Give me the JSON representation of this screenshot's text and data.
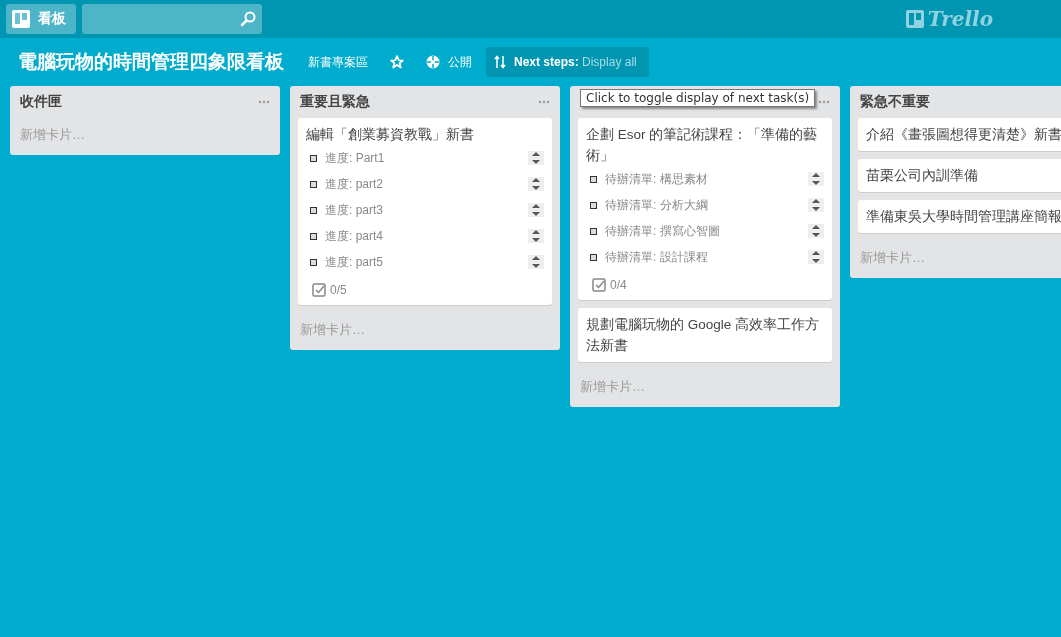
{
  "header": {
    "boards_button": "看板",
    "logo_text": "Trello"
  },
  "board": {
    "title": "電腦玩物的時間管理四象限看板",
    "team": "新書專案區",
    "starred": false,
    "visibility": "公開",
    "next_steps": {
      "label": "Next steps:",
      "value": "Display all"
    }
  },
  "tooltip": "Click to toggle display of next task(s)",
  "lists": [
    {
      "title": "收件匣",
      "add_card": "新增卡片…"
    },
    {
      "title": "重要且緊急",
      "cards": [
        {
          "title": "編輯「創業募資教戰」新書",
          "tasks": [
            "進度: Part1",
            "進度: part2",
            "進度: part3",
            "進度: part4",
            "進度: part5"
          ],
          "checklist": "0/5"
        }
      ],
      "add_card": "新增卡片…"
    },
    {
      "cards": [
        {
          "title": "企劃 Esor 的筆記術課程：「準備的藝術」",
          "tasks": [
            "待辦清單: 構思素材",
            "待辦清單: 分析大綱",
            "待辦清單: 撰寫心智圖",
            "待辦清單: 設計課程"
          ],
          "checklist": "0/4"
        },
        {
          "title": "規劃電腦玩物的 Google 高效率工作方法新書"
        }
      ],
      "add_card": "新增卡片…"
    },
    {
      "title": "緊急不重要",
      "cards": [
        {
          "title": "介紹《畫張圖想得更清楚》新書"
        },
        {
          "title": "苗栗公司內訓準備"
        },
        {
          "title": "準備東吳大學時間管理講座簡報"
        }
      ],
      "add_card": "新增卡片…"
    }
  ]
}
